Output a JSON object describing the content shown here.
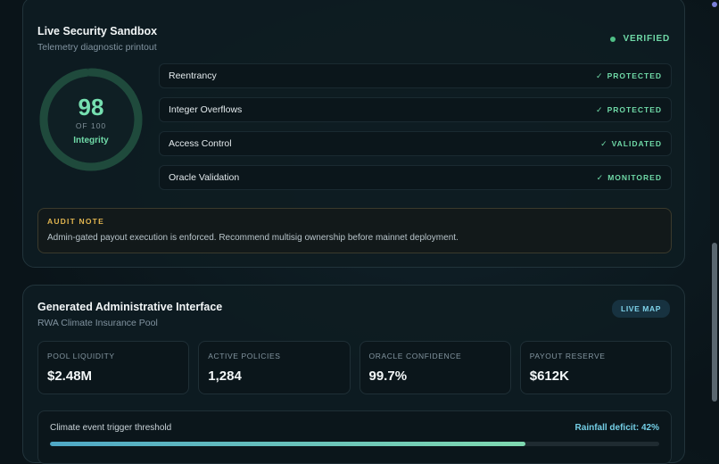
{
  "sandbox": {
    "title": "Live Security Sandbox",
    "subtitle": "Telemetry diagnostic printout",
    "status": "VERIFIED",
    "gauge": {
      "score": "98",
      "of": "OF 100",
      "label": "Integrity",
      "fraction": 0.98
    },
    "checks": [
      {
        "label": "Reentrancy",
        "status": "PROTECTED"
      },
      {
        "label": "Integer Overflows",
        "status": "PROTECTED"
      },
      {
        "label": "Access Control",
        "status": "VALIDATED"
      },
      {
        "label": "Oracle Validation",
        "status": "MONITORED"
      }
    ],
    "audit": {
      "title": "AUDIT NOTE",
      "text": "Admin-gated payout execution is enforced. Recommend multisig ownership before mainnet deployment."
    }
  },
  "admin": {
    "title": "Generated Administrative Interface",
    "subtitle": "RWA Climate Insurance Pool",
    "badge": "LIVE MAP",
    "stats": [
      {
        "label": "POOL LIQUIDITY",
        "value": "$2.48M"
      },
      {
        "label": "ACTIVE POLICIES",
        "value": "1,284"
      },
      {
        "label": "ORACLE CONFIDENCE",
        "value": "99.7%"
      },
      {
        "label": "PAYOUT RESERVE",
        "value": "$612K"
      }
    ],
    "threshold": {
      "label": "Climate event trigger threshold",
      "value": "Rainfall deficit: 42%",
      "progress": 0.78
    }
  },
  "colors": {
    "accent_green": "#6fd9a7",
    "accent_cyan": "#74cfe6",
    "audit_gold": "#e0b44f",
    "background": "#0a1419"
  },
  "icons": {
    "check": "check-icon",
    "status_dot": "status-dot-icon"
  }
}
